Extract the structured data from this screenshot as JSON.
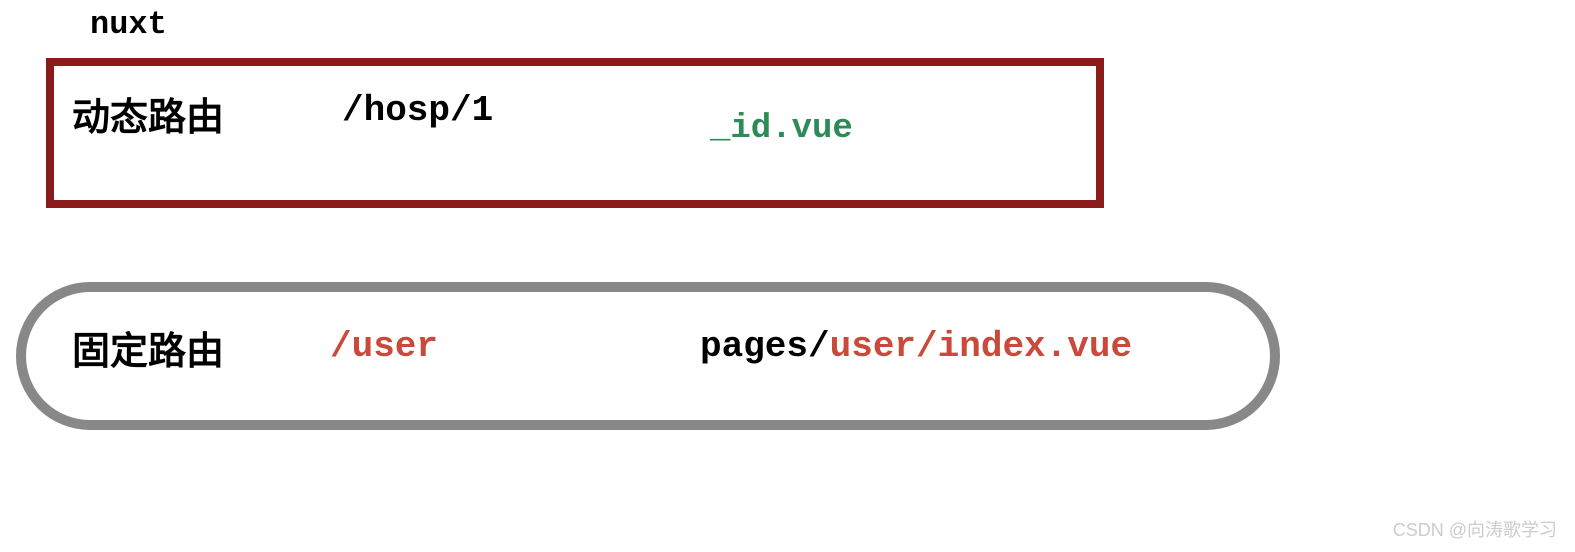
{
  "header": "nuxt",
  "dynamic": {
    "label": "动态路由",
    "path": "/hosp/1",
    "file": "_id.vue"
  },
  "fixed": {
    "label": "固定路由",
    "path": "/user",
    "file_prefix": "pages/",
    "file_highlight": "user/index.vue"
  },
  "watermark": "CSDN @向涛歌学习"
}
